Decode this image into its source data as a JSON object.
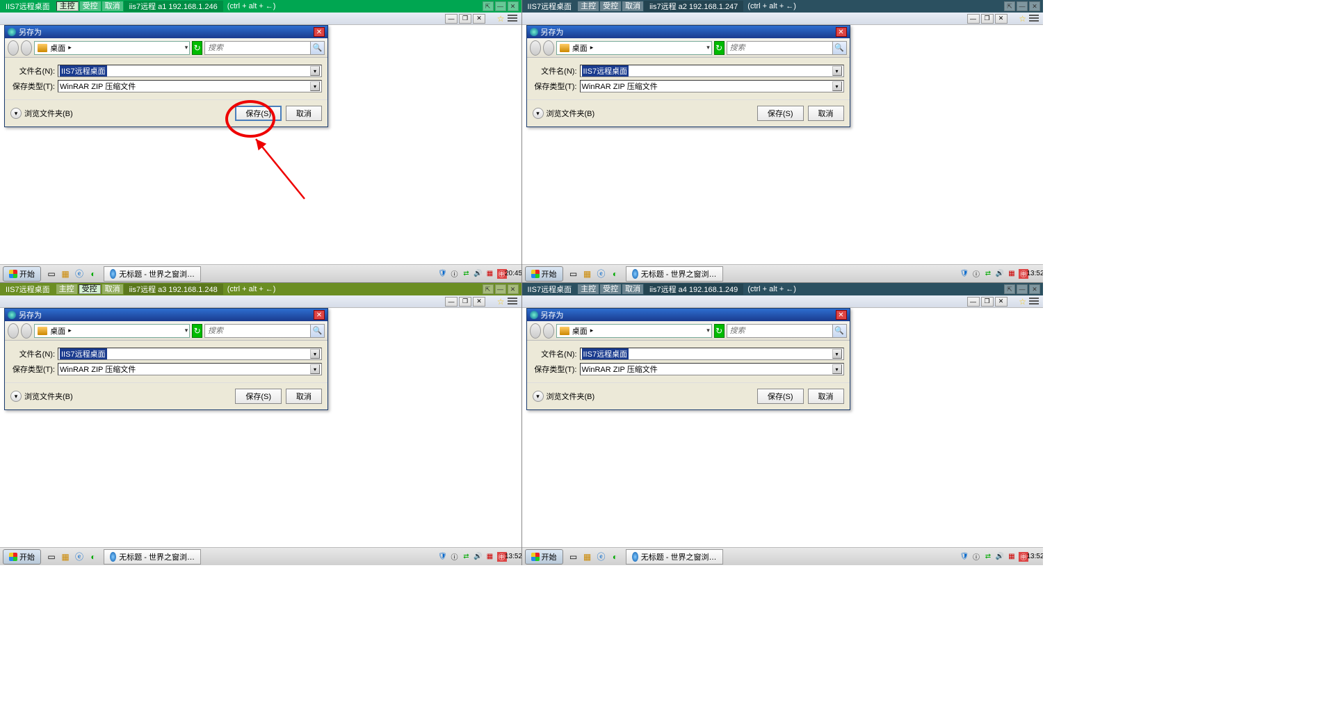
{
  "panes": [
    {
      "id": "a1",
      "bar_class": "green",
      "tab_app": "IIS7远程桌面",
      "tab_main": "主控",
      "tab_ctrl": "受控",
      "tab_cancel": "取消",
      "conn": "iis7远程   a1   192.168.1.246",
      "hint": "(ctrl + alt + ←)",
      "save_default": true,
      "annotate": true,
      "filename_label": "文件名(N):",
      "filetype_label": "保存类型(T):"
    },
    {
      "id": "a2",
      "bar_class": "dark",
      "tab_app": "IIS7远程桌面",
      "tab_main": "主控",
      "tab_ctrl": "受控",
      "tab_cancel": "取消",
      "conn": "iis7远程   a2   192.168.1.247",
      "hint": "(ctrl + alt + ←)",
      "save_default": false,
      "annotate": false,
      "filename_label": "文件名(N):",
      "filetype_label": "保存类型(T):"
    },
    {
      "id": "a3",
      "bar_class": "olive",
      "tab_app": "IIS7远程桌面",
      "tab_main": "主控",
      "tab_ctrl": "受控",
      "tab_cancel": "取消",
      "conn": "iis7远程   a3   192.168.1.248",
      "hint": "(ctrl + alt + ←)",
      "save_default": false,
      "annotate": false,
      "filename_label": "文件名(N):",
      "filetype_label": "保存类型(T):"
    },
    {
      "id": "a4",
      "bar_class": "dark",
      "tab_app": "IIS7远程桌面",
      "tab_main": "主控",
      "tab_ctrl": "受控",
      "tab_cancel": "取消",
      "conn": "iis7远程   a4   192.168.1.249",
      "hint": "(ctrl + alt + ←)",
      "save_default": false,
      "annotate": false,
      "filename_label": "文件名(N):",
      "filetype_label": "保存类型(T):"
    }
  ],
  "dialog": {
    "title": "另存为",
    "location": "桌面",
    "search_placeholder": "搜索",
    "filename_value": "IIS7远程桌面",
    "filetype_value": "WinRAR ZIP 压缩文件",
    "browse": "浏览文件夹(B)",
    "save": "保存(S)",
    "cancel": "取消"
  },
  "taskbar": {
    "start": "开始",
    "task_title": "无标题 - 世界之窗浏…",
    "time_left": "20:45",
    "time_other": "13:52"
  }
}
